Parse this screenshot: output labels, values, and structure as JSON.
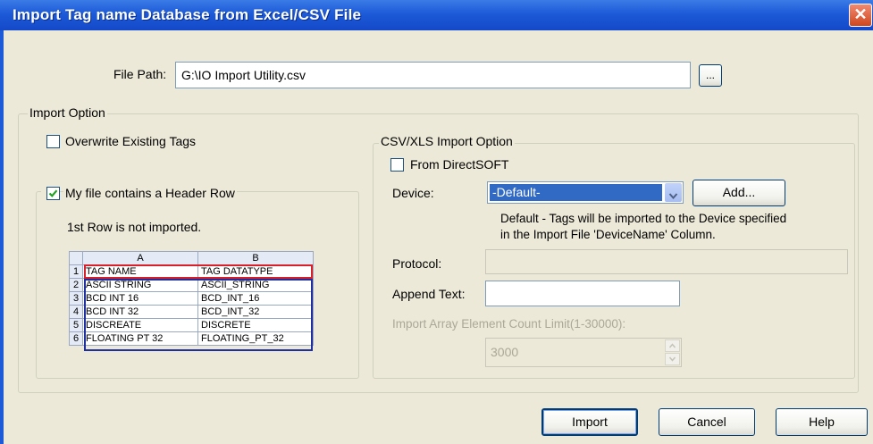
{
  "window": {
    "title": "Import Tag name Database from Excel/CSV File",
    "close_label": "✕"
  },
  "file_path": {
    "label": "File Path:",
    "value": "G:\\IO Import Utility.csv",
    "browse_label": "..."
  },
  "import_option": {
    "legend": "Import Option",
    "overwrite": {
      "label": "Overwrite Existing Tags",
      "checked": false
    },
    "header_row": {
      "label": "My file contains a Header Row",
      "checked": true
    },
    "note": "1st Row is not imported.",
    "preview": {
      "columns": [
        "A",
        "B"
      ],
      "rows": [
        {
          "n": "1",
          "a": "TAG NAME",
          "b": "TAG DATATYPE"
        },
        {
          "n": "2",
          "a": "ASCII STRING",
          "b": "ASCII_STRING"
        },
        {
          "n": "3",
          "a": "BCD INT 16",
          "b": "BCD_INT_16"
        },
        {
          "n": "4",
          "a": "BCD INT 32",
          "b": "BCD_INT_32"
        },
        {
          "n": "5",
          "a": "DISCREATE",
          "b": "DISCRETE"
        },
        {
          "n": "6",
          "a": "FLOATING PT 32",
          "b": "FLOATING_PT_32"
        }
      ]
    }
  },
  "csv_option": {
    "legend": "CSV/XLS Import Option",
    "from_directsoft": {
      "label": "From DirectSOFT",
      "checked": false
    },
    "device": {
      "label": "Device:",
      "selected": "-Default-",
      "add_label": "Add..."
    },
    "device_note_1": "Default - Tags will be imported to the Device specified",
    "device_note_2": "in the Import File 'DeviceName' Column.",
    "protocol": {
      "label": "Protocol:",
      "value": ""
    },
    "append_text": {
      "label": "Append Text:",
      "value": ""
    },
    "array_limit": {
      "label": "Import Array Element Count Limit(1-30000):",
      "value": "3000"
    }
  },
  "buttons": {
    "import": "Import",
    "cancel": "Cancel",
    "help": "Help"
  },
  "colors": {
    "title_bar": "#1c5ad8",
    "select_highlight": "#316ac5",
    "header_row_outline": "#d8202a",
    "data_rows_outline": "#1f2f9e"
  }
}
